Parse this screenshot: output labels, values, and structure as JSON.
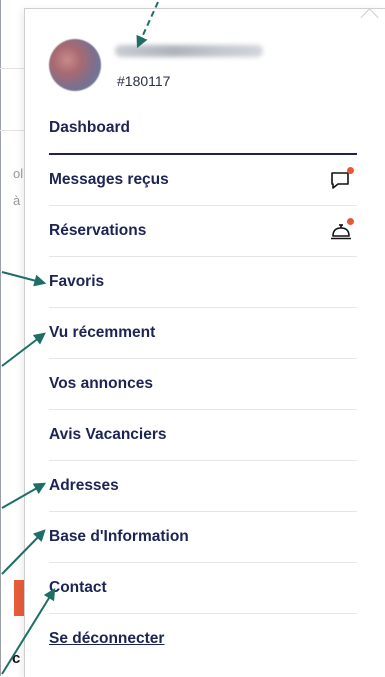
{
  "user": {
    "id": "#180117"
  },
  "menu": {
    "items": [
      {
        "label": "Dashboard"
      },
      {
        "label": "Messages reçus"
      },
      {
        "label": "Réservations"
      },
      {
        "label": "Favoris"
      },
      {
        "label": "Vu récemment"
      },
      {
        "label": "Vos annonces"
      },
      {
        "label": "Avis Vacanciers"
      },
      {
        "label": "Adresses"
      },
      {
        "label": "Base d'Information"
      },
      {
        "label": "Contact"
      },
      {
        "label": "Se déconnecter"
      }
    ]
  },
  "background": {
    "fragment_1": "ol",
    "fragment_2": "à",
    "fragment_3": "c"
  },
  "icons": {
    "messages": "chat-bubble-icon",
    "reservations": "service-bell-icon"
  },
  "colors": {
    "text": "#1d2454",
    "notification_dot": "#e8563a",
    "arrow": "#1f6e66",
    "accent_bar": "#e85d3c"
  }
}
